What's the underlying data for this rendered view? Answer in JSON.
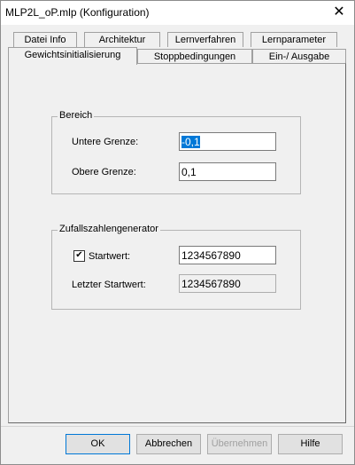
{
  "window": {
    "title": "MLP2L_oP.mlp (Konfiguration)",
    "close_glyph": "✕"
  },
  "tabs": {
    "row_back": [
      "Datei Info",
      "Architektur",
      "Lernverfahren",
      "Lernparameter"
    ],
    "row_front": [
      "Gewichtsinitialisierung",
      "Stoppbedingungen",
      "Ein-/ Ausgabe"
    ],
    "selected": "Gewichtsinitialisierung"
  },
  "bereich": {
    "group_label": "Bereich",
    "untere_label": "Untere Grenze:",
    "untere_value": "-0,1",
    "obere_label": "Obere Grenze:",
    "obere_value": "0,1"
  },
  "zufall": {
    "group_label": "Zufallszahlengenerator",
    "startwert_checked": true,
    "startwert_label": "Startwert:",
    "startwert_value": "1234567890",
    "letzter_label": "Letzter Startwert:",
    "letzter_value": "1234567890"
  },
  "buttons": {
    "ok": "OK",
    "cancel": "Abbrechen",
    "apply": "Übernehmen",
    "help": "Hilfe"
  }
}
